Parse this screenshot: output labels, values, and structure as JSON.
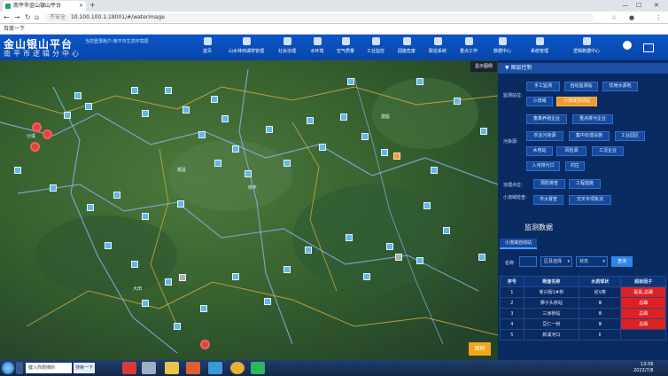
{
  "browser": {
    "tab_title": "南平市金山银山平台",
    "new_tab": "+",
    "address": "10.100.100.1:18001/#/waterimage",
    "security": "不安全",
    "bookmark": "百度一下"
  },
  "header": {
    "title": "金山银山平台",
    "subtitle": "南平市逻辑分中心",
    "user_line": "当前登录账户:南平市生态环境局",
    "nav": [
      "首页",
      "山水林田湖草管理",
      "社会治理",
      "水环境",
      "空气质量",
      "工业监控",
      "固废危废",
      "联巡系统",
      "重点工作",
      "数据中心",
      "系统管理",
      "逻辑数据中心"
    ]
  },
  "map": {
    "show_legend_label": "显示图例",
    "action_button": "图例",
    "labels": [
      "沙溪",
      "大田",
      "南平",
      "建瓯",
      "顺昌"
    ]
  },
  "panel": {
    "section_title": "▼ 图层控制",
    "monitor_label": "监测站位:",
    "monitor_points": [
      "手工监测",
      "自动监测站",
      "饮用水源地",
      "小流域",
      "小流域自动站"
    ],
    "pollution_label": "污染源:",
    "pollution_sources": [
      "畜禽养殖企业",
      "重点排污企业",
      "农业污染源",
      "集中处理设施",
      "工业园区",
      "水电站",
      "风险源",
      "工况企业",
      "入河排污口",
      "村庄"
    ],
    "governance_label": "治理点位:",
    "governance": [
      "预防排查",
      "工程措施"
    ],
    "basin_label": "小流域检查:",
    "basin": [
      "市大督查",
      "交叉专项执法"
    ],
    "monitor_title": "监测数据",
    "data_tab": "小流域自动站",
    "filter_name_label": "名称",
    "filter_district": "区县选择",
    "filter_status": "状态",
    "query_button": "查询",
    "table": {
      "headers": [
        "序号",
        "断面名称",
        "水质现状",
        "超标因子"
      ],
      "rows": [
        [
          "1",
          "新兴街1#桥",
          "劣Ⅴ类",
          "氨氮,总磷"
        ],
        [
          "2",
          "狮子头桥站",
          "Ⅲ",
          "总磷"
        ],
        [
          "3",
          "三洲桥站",
          "Ⅲ",
          "总磷"
        ],
        [
          "4",
          "豆仁一桥",
          "Ⅲ",
          "总磷"
        ],
        [
          "5",
          "新溪河口",
          "Ⅱ",
          ""
        ]
      ]
    }
  },
  "taskbar": {
    "search_placeholder": "键入你想搜的",
    "search_button": "搜索一下",
    "time": "13:56",
    "date": "2022/7/8"
  },
  "colors": {
    "header_blue": "#0a56c8",
    "panel_bg": "#0a2a62",
    "chip_active": "#f09a2a",
    "alert_red": "#e02020",
    "marker": "#5fb8e6"
  }
}
